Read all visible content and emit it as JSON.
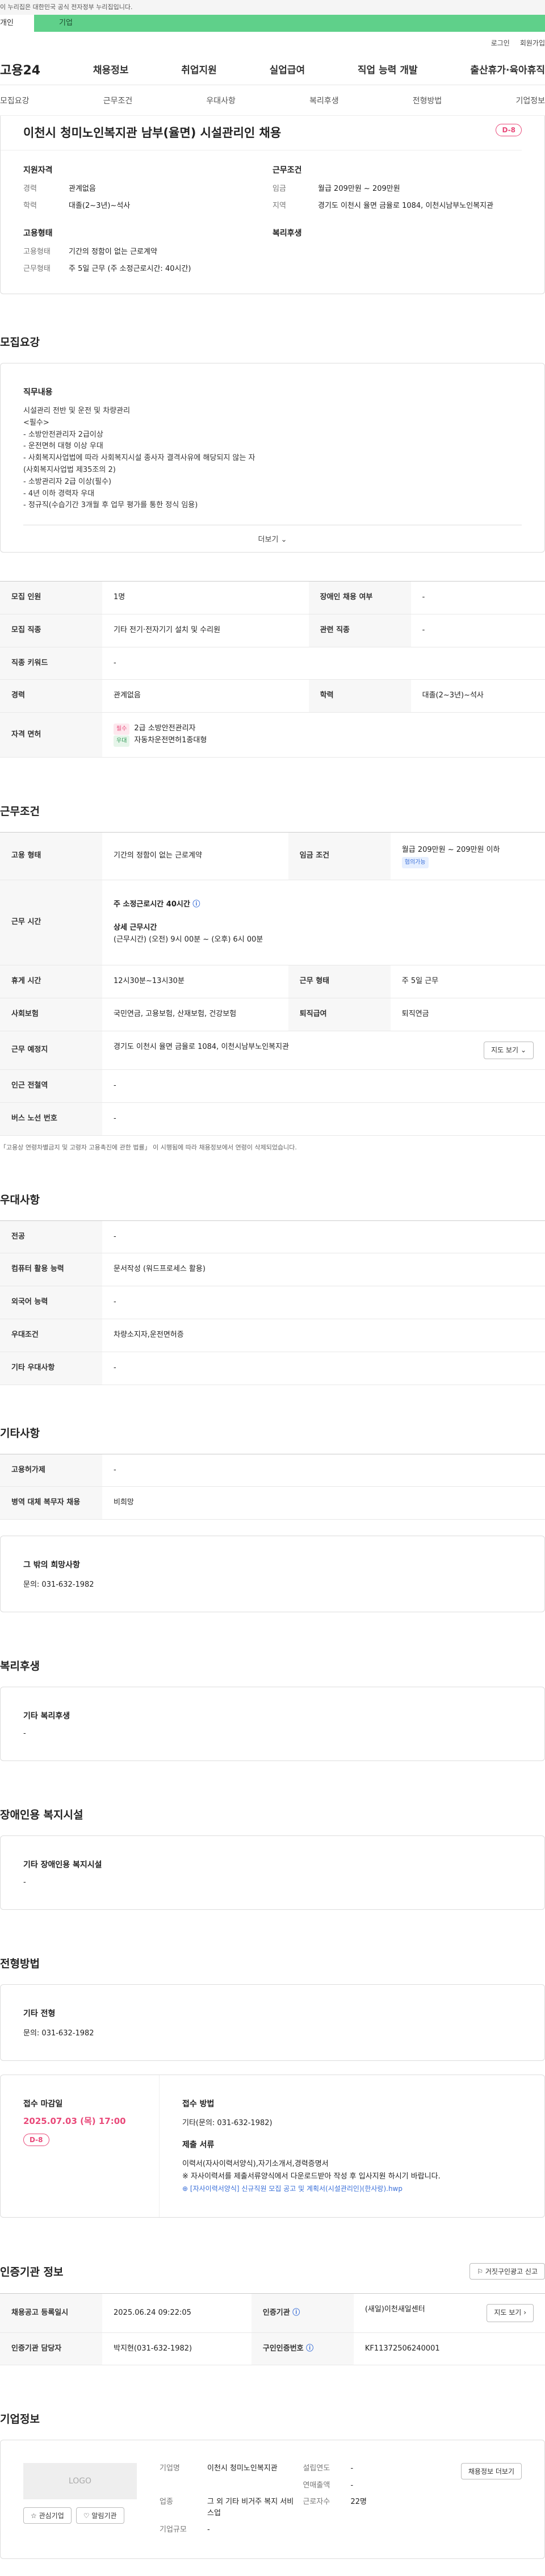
{
  "topbar": "이 누리집은 대한민국 공식 전자정부 누리집입니다.",
  "category": {
    "personal": "개인",
    "corporate": "기업"
  },
  "util": {
    "login": "로그인",
    "signup": "회원가입"
  },
  "gnb": {
    "logo": "고용24",
    "items": [
      "채용정보",
      "취업지원",
      "실업급여",
      "직업 능력 개발",
      "출산휴가·육아휴직"
    ]
  },
  "subnav": [
    "모집요강",
    "근무조건",
    "우대사항",
    "복리후생",
    "전형방법",
    "기업정보"
  ],
  "job": {
    "title": "이천시 청미노인복지관 남부(율면) 시설관리인 채용",
    "dday": "D-8",
    "qual_title": "지원자격",
    "career_label": "경력",
    "career": "관계없음",
    "edu_label": "학력",
    "edu": "대졸(2~3년)~석사",
    "cond_title": "근무조건",
    "wage_label": "임금",
    "wage": "월급 209만원 ~ 209만원",
    "area_label": "지역",
    "area": "경기도 이천시 율면 금율로 1084, 이천시남부노인복지관",
    "emp_title": "고용형태",
    "emp_label": "고용형태",
    "emp": "기간의 정함이 없는 근로계약",
    "work_label": "근무형태",
    "work": "주 5일 근무 (주 소정근로시간: 40시간)",
    "welfare_title": "복리후생"
  },
  "recruit": {
    "title": "모집요강",
    "duty_title": "직무내용",
    "duty_text": "시설관리 전반 및 운전 및 차량관리\n<필수>\n  - 소방안전관리자 2급이상\n  - 운전면허 대형 이상 우대\n  - 사회복지사업법에 따라 사회복지시설 종사자 결격사유에 해당되지 않는 자\n    (사회복지사업법 제35조의 2)\n  - 소방관리자 2급 이상(필수)\n  - 4년 이하 경력자 우대\n  - 정규직(수습기간 3개월 후 업무 평가를 통한 정식 임용)",
    "more": "더보기",
    "rows": {
      "count_k": "모집 인원",
      "count_v": "1명",
      "dis_k": "장애인 채용 여부",
      "dis_v": "-",
      "job_k": "모집 직종",
      "job_v": "기타 전기·전자기기 설치 및 수리원",
      "rel_k": "관련 직종",
      "rel_v": "-",
      "kw_k": "직종 키워드",
      "kw_v": "-",
      "career_k": "경력",
      "career_v": "관계없음",
      "edu_k": "학력",
      "edu_v": "대졸(2~3년)~석사",
      "lic_k": "자격 면허",
      "lic_req_tag": "필수",
      "lic_req": "2급 소방안전관리자",
      "lic_pref_tag": "우대",
      "lic_pref": "자동차운전면허1종대형"
    }
  },
  "conditions": {
    "title": "근무조건",
    "type_k": "고용 형태",
    "type_v": "기간의 정함이 없는 근로계약",
    "wage_k": "임금 조건",
    "wage_v": "월급 209만원 ~ 209만원 이하",
    "wage_tag": "협의가능",
    "time_k": "근무 시간",
    "time_week": "주 소정근로시간 40시간",
    "time_detail_t": "상세 근무시간",
    "time_detail": "(근무시간) (오전) 9시 00분 ~ (오후) 6시 00분",
    "rest_k": "휴게 시간",
    "rest_v": "12시30분~13시30분",
    "form_k": "근무 형태",
    "form_v": "주 5일 근무",
    "ins_k": "사회보험",
    "ins_v": "국민연금, 고용보험, 산재보험, 건강보험",
    "ret_k": "퇴직급여",
    "ret_v": "퇴직연금",
    "loc_k": "근무 예정지",
    "loc_v": "경기도 이천시 율면 금율로 1084, 이천시남부노인복지관",
    "map_btn": "지도 보기",
    "sub_k": "인근 전철역",
    "sub_v": "-",
    "bus_k": "버스 노선 번호",
    "bus_v": "-",
    "note": "「고용상 연령차별금지 및 고령자 고용촉진에 관한 법률」 이 시행됨에 따라 채용정보에서 연령이 삭제되었습니다."
  },
  "preference": {
    "title": "우대사항",
    "major_k": "전공",
    "major_v": "-",
    "pc_k": "컴퓨터 활용 능력",
    "pc_v": "문서작성 (워드프로세스 활용)",
    "lang_k": "외국어 능력",
    "lang_v": "-",
    "cond_k": "우대조건",
    "cond_v": "차량소지자,운전면허증",
    "etc_k": "기타 우대사항",
    "etc_v": "-"
  },
  "etc": {
    "title": "기타사항",
    "cnt_k": "고용허가제",
    "cnt_v": "-",
    "mil_k": "병역 대체 복무자 채용",
    "mil_v": "비희망",
    "wish_t": "그 밖의 희망사항",
    "wish_v": "문의: 031-632-1982"
  },
  "welfare": {
    "title": "복리후생",
    "sub_t": "기타 복리후생",
    "sub_v": "-"
  },
  "disabled": {
    "title": "장애인용 복지시설",
    "sub_t": "기타 장애인용 복지시설",
    "sub_v": "-"
  },
  "selection": {
    "title": "전형방법",
    "sub_t": "기타 전형",
    "sub_v": "문의: 031-632-1982",
    "deadline_t": "접수 마감일",
    "deadline_v": "2025.07.03 (목) 17:00",
    "dday": "D-8",
    "method_t": "접수 방법",
    "method_v": "기타(문의: 031-632-1982)",
    "docs_t": "제출 서류",
    "docs_v": "이력서(자사이력서양식),자기소개서,경력증명서",
    "docs_note": "※ 자사이력서를 제출서류양식에서 다운로드받아 작성 후 입사지원 하시기 바랍니다.",
    "docs_file": "[자사이력서양식] 신규직원 모집 공고 및 계획서(시설관리인)(한사랑).hwp"
  },
  "agency": {
    "title": "인증기관 정보",
    "report_btn": "거짓구인광고 신고",
    "reg_k": "채용공고 등록일시",
    "reg_v": "2025.06.24 09:22:05",
    "org_k": "인증기관",
    "org_v": "(새일)이천새일센터",
    "map_btn": "지도 보기",
    "mgr_k": "인증기관 담당자",
    "mgr_v": "박지현(031-632-1982)",
    "no_k": "구인인증번호",
    "no_v": "KF11372506240001"
  },
  "company": {
    "title": "기업정보",
    "logo": "LOGO",
    "fav_btn": "관심기업",
    "noti_btn": "알림기관",
    "name_k": "기업명",
    "name_v": "이천시 청미노인복지관",
    "year_k": "설립연도",
    "year_v": "-",
    "sales_k": "연매출액",
    "sales_v": "-",
    "ind_k": "업종",
    "ind_v": "그 외 기타 비거주 복지 서비스업",
    "emp_k": "근로자수",
    "emp_v": "22명",
    "size_k": "기업규모",
    "size_v": "-",
    "more_btn": "채용정보 더보기"
  }
}
